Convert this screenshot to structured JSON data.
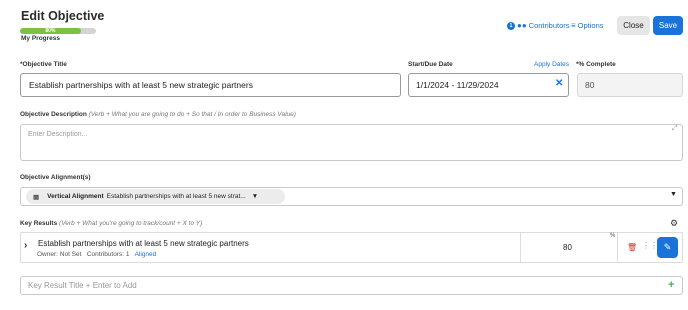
{
  "header": {
    "title": "Edit Objective",
    "progress": {
      "percent": 80,
      "label_text": "80%",
      "caption": "My Progress",
      "fill_color": "#7cc142"
    },
    "contributors_label": "Contributors",
    "contributors_count": "1",
    "options_label": "Options",
    "close_label": "Close",
    "save_label": "Save"
  },
  "objective_title": {
    "label": "*Objective Title",
    "value": "Establish partnerships with at least 5 new strategic partners"
  },
  "dates": {
    "label": "Start/Due Date",
    "apply_label": "Apply Dates",
    "value": "1/1/2024 - 11/29/2024",
    "clear_icon": "close-icon"
  },
  "percent_complete": {
    "label": "*% Complete",
    "value": "80"
  },
  "description": {
    "label": "Objective Description",
    "hint": "(Verb + What you are going to do + So that / In order to Business Value)",
    "placeholder": "Enter Description..."
  },
  "alignment": {
    "label": "Objective Alignment(s)",
    "chip_label": "Vertical Alignment",
    "chip_value": "Establish partnerships with at least 5 new strat..."
  },
  "key_results": {
    "label": "Key Results",
    "hint": "(Verb + What you're going to track/count + X to Y)",
    "rows": [
      {
        "title": "Establish partnerships with at least 5 new strategic partners",
        "owner": "Owner: Not Set",
        "contributors": "Contributors: 1",
        "aligned": "Aligned",
        "percent_symbol": "%",
        "value": "80"
      }
    ],
    "add_placeholder": "Key Result Title + Enter to Add"
  },
  "colors": {
    "accent": "#1a73d9",
    "delete": "#d93025",
    "add": "#4caf50"
  }
}
